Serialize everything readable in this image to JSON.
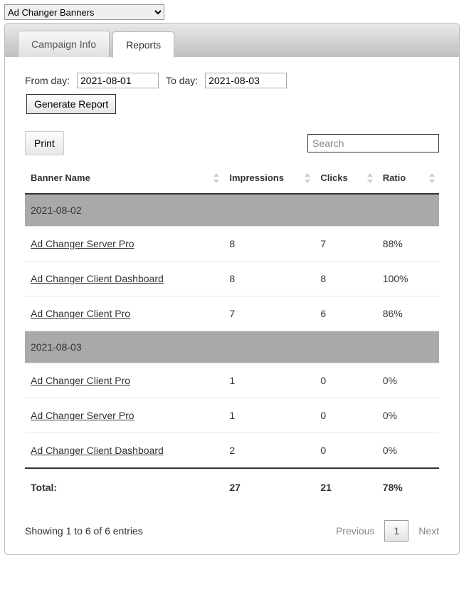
{
  "top_select": {
    "selected": "Ad Changer Banners"
  },
  "tabs": {
    "campaign_info": "Campaign Info",
    "reports": "Reports"
  },
  "filters": {
    "from_label": "From day:",
    "from_value": "2021-08-01",
    "to_label": "To day:",
    "to_value": "2021-08-03",
    "generate_label": "Generate Report"
  },
  "toolbar": {
    "print_label": "Print",
    "search_placeholder": "Search"
  },
  "table": {
    "headers": {
      "banner": "Banner Name",
      "impressions": "Impressions",
      "clicks": "Clicks",
      "ratio": "Ratio"
    },
    "groups": [
      {
        "date": "2021-08-02",
        "rows": [
          {
            "name": "Ad Changer Server Pro",
            "impressions": "8",
            "clicks": "7",
            "ratio": "88%"
          },
          {
            "name": "Ad Changer Client Dashboard",
            "impressions": "8",
            "clicks": "8",
            "ratio": "100%"
          },
          {
            "name": "Ad Changer Client Pro",
            "impressions": "7",
            "clicks": "6",
            "ratio": "86%"
          }
        ]
      },
      {
        "date": "2021-08-03",
        "rows": [
          {
            "name": "Ad Changer Client Pro",
            "impressions": "1",
            "clicks": "0",
            "ratio": "0%"
          },
          {
            "name": "Ad Changer Server Pro",
            "impressions": "1",
            "clicks": "0",
            "ratio": "0%"
          },
          {
            "name": "Ad Changer Client Dashboard",
            "impressions": "2",
            "clicks": "0",
            "ratio": "0%"
          }
        ]
      }
    ],
    "total": {
      "label": "Total:",
      "impressions": "27",
      "clicks": "21",
      "ratio": "78%"
    }
  },
  "footer": {
    "info": "Showing 1 to 6 of 6 entries",
    "prev": "Previous",
    "next": "Next",
    "page": "1"
  }
}
